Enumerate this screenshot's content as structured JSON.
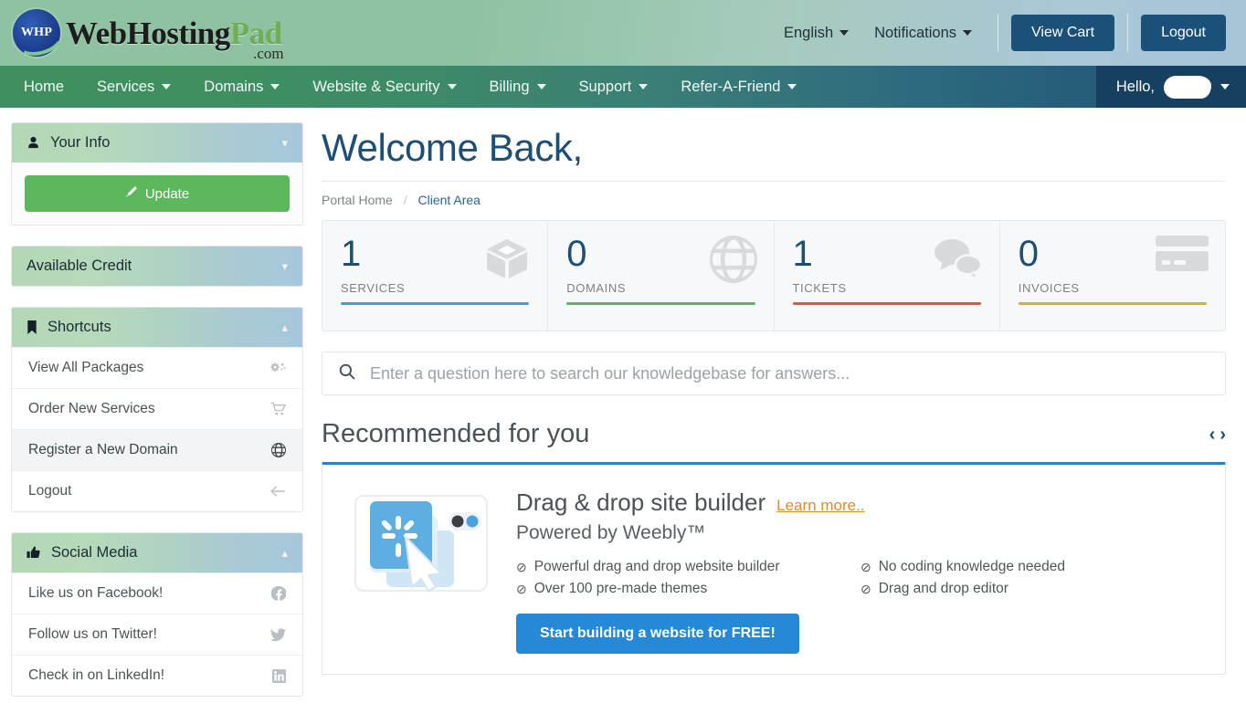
{
  "header": {
    "logo": {
      "badge_text": "WHP",
      "name_main": "WebHosting",
      "name_accent": "Pad",
      "name_tld": ".com"
    },
    "language": "English",
    "notifications": "Notifications",
    "view_cart": "View Cart",
    "logout": "Logout"
  },
  "nav": {
    "items": [
      {
        "label": "Home",
        "has_caret": false
      },
      {
        "label": "Services",
        "has_caret": true
      },
      {
        "label": "Domains",
        "has_caret": true
      },
      {
        "label": "Website & Security",
        "has_caret": true
      },
      {
        "label": "Billing",
        "has_caret": true
      },
      {
        "label": "Support",
        "has_caret": true
      },
      {
        "label": "Refer-A-Friend",
        "has_caret": true
      }
    ],
    "hello_label": "Hello,",
    "hello_username": ""
  },
  "sidebar": {
    "your_info": {
      "title": "Your Info",
      "icon": "user-icon",
      "update_label": "Update"
    },
    "available_credit": {
      "title": "Available Credit",
      "icon": "none"
    },
    "shortcuts": {
      "title": "Shortcuts",
      "icon": "bookmark-icon",
      "items": [
        {
          "label": "View All Packages",
          "icon": "gears-icon",
          "active": false
        },
        {
          "label": "Order New Services",
          "icon": "cart-icon",
          "active": false
        },
        {
          "label": "Register a New Domain",
          "icon": "globe-icon",
          "active": true
        },
        {
          "label": "Logout",
          "icon": "arrow-left-icon",
          "active": false
        }
      ]
    },
    "social_media": {
      "title": "Social Media",
      "icon": "thumbs-up-icon",
      "items": [
        {
          "label": "Like us on Facebook!",
          "icon": "facebook-icon"
        },
        {
          "label": "Follow us on Twitter!",
          "icon": "twitter-icon"
        },
        {
          "label": "Check in on LinkedIn!",
          "icon": "linkedin-icon"
        }
      ]
    }
  },
  "main": {
    "welcome_title": "Welcome Back,",
    "breadcrumb": {
      "first": "Portal Home",
      "separator": "/",
      "current": "Client Area"
    },
    "stats": [
      {
        "value": "1",
        "label": "SERVICES",
        "icon": "box-icon",
        "color": "#44a0d4"
      },
      {
        "value": "0",
        "label": "DOMAINS",
        "icon": "globe-icon",
        "color": "#5cb85c"
      },
      {
        "value": "1",
        "label": "TICKETS",
        "icon": "chat-bubbles-icon",
        "color": "#d9534f"
      },
      {
        "value": "0",
        "label": "INVOICES",
        "icon": "credit-card-icon",
        "color": "#e0a93c"
      }
    ],
    "search": {
      "placeholder": "Enter a question here to search our knowledgebase for answers...",
      "value": "",
      "icon": "search-icon"
    },
    "recommended": {
      "title": "Recommended for you",
      "prev_arrow": "‹",
      "next_arrow": "›"
    },
    "promo": {
      "image_icon": "site-builder-icon",
      "heading": "Drag & drop site builder",
      "learn_more": "Learn more..",
      "subheading": "Powered by Weebly™",
      "features": [
        "Powerful drag and drop website builder",
        "No coding knowledge needed",
        "Over 100 pre-made themes",
        "Drag and drop editor"
      ],
      "feature_check": "⊘",
      "cta_label": "Start building a website for FREE!",
      "accent_color": "#2e7fc4"
    }
  }
}
